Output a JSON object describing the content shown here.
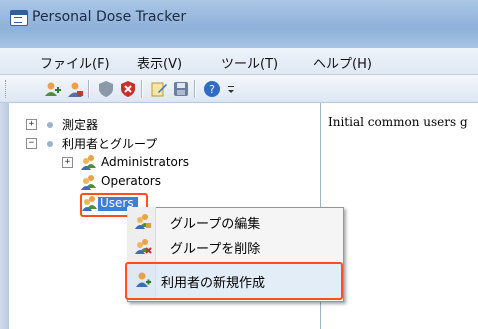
{
  "window": {
    "title": "Personal Dose Tracker"
  },
  "menu": [
    {
      "label": "ファイル(F)"
    },
    {
      "label": "表示(V)"
    },
    {
      "label": "ツール(T)"
    },
    {
      "label": "ヘルプ(H)"
    }
  ],
  "toolbar": {
    "icons": [
      "add-user-icon",
      "user-icon",
      "shield-icon",
      "shield-delete-icon",
      "edit-icon",
      "disk-icon",
      "help-icon",
      "dropdown-icon"
    ]
  },
  "tree": {
    "items": [
      {
        "label": "測定器"
      },
      {
        "label": "利用者とグループ"
      },
      {
        "label": "Administrators"
      },
      {
        "label": "Operators"
      },
      {
        "label": "Users"
      }
    ]
  },
  "details": {
    "text": "Initial common users g"
  },
  "context_menu": {
    "items": [
      {
        "label": "グループの編集"
      },
      {
        "label": "グループを削除"
      },
      {
        "label": "利用者の新規作成"
      }
    ]
  },
  "colors": {
    "highlight_border": "#ff4e1f",
    "selection": "#3d7fd6"
  }
}
